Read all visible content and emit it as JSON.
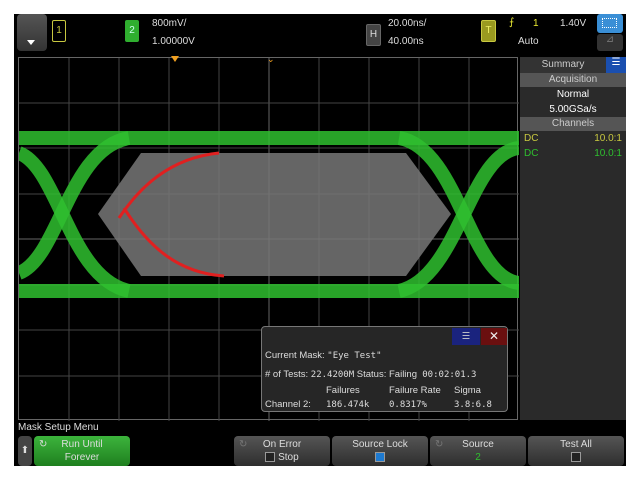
{
  "header": {
    "menu_icon": "chevron-down-icon",
    "ch1": "1",
    "ch2": "2",
    "ch2_scale": "800mV/",
    "ch2_offset": "1.00000V",
    "h_label": "H",
    "h_scale": "20.00ns/",
    "h_delay": "40.00ns",
    "t_label": "T",
    "trigger_source": "1",
    "trigger_level": "1.40V",
    "trigger_mode": "Auto",
    "colors": {
      "ch1": "#c8c840",
      "ch2": "#2fae2f",
      "accent": "#3a8fd6"
    }
  },
  "side": {
    "tab": "Summary",
    "acq_header": "Acquisition",
    "acq_mode": "Normal",
    "acq_rate": "5.00GSa/s",
    "ch_header": "Channels",
    "channels": [
      {
        "coupling": "DC",
        "probe": "10.0:1"
      },
      {
        "coupling": "DC",
        "probe": "10.0:1"
      }
    ]
  },
  "dialog": {
    "mask_label": "Current Mask:",
    "mask_name": "\"Eye Test\"",
    "tests_label": "# of Tests:",
    "tests": "22.4200M",
    "status_label": "Status: Failing",
    "elapsed": "00:02:01.3",
    "col_failures": "Failures",
    "col_rate": "Failure Rate",
    "col_sigma": "Sigma",
    "row_label": "Channel 2:",
    "failures": "186.474k",
    "rate": "0.8317%",
    "sigma": "3.8:6.8"
  },
  "menu": {
    "title": "Mask Setup Menu",
    "run_until_label": "Run Until",
    "run_until_value": "Forever",
    "on_error_label": "On Error",
    "on_error_value": "Stop",
    "source_lock_label": "Source Lock",
    "source_label": "Source",
    "source_value": "2",
    "test_all_label": "Test All",
    "source_lock_checked": true,
    "stop_checked": false,
    "test_all_checked": false
  }
}
